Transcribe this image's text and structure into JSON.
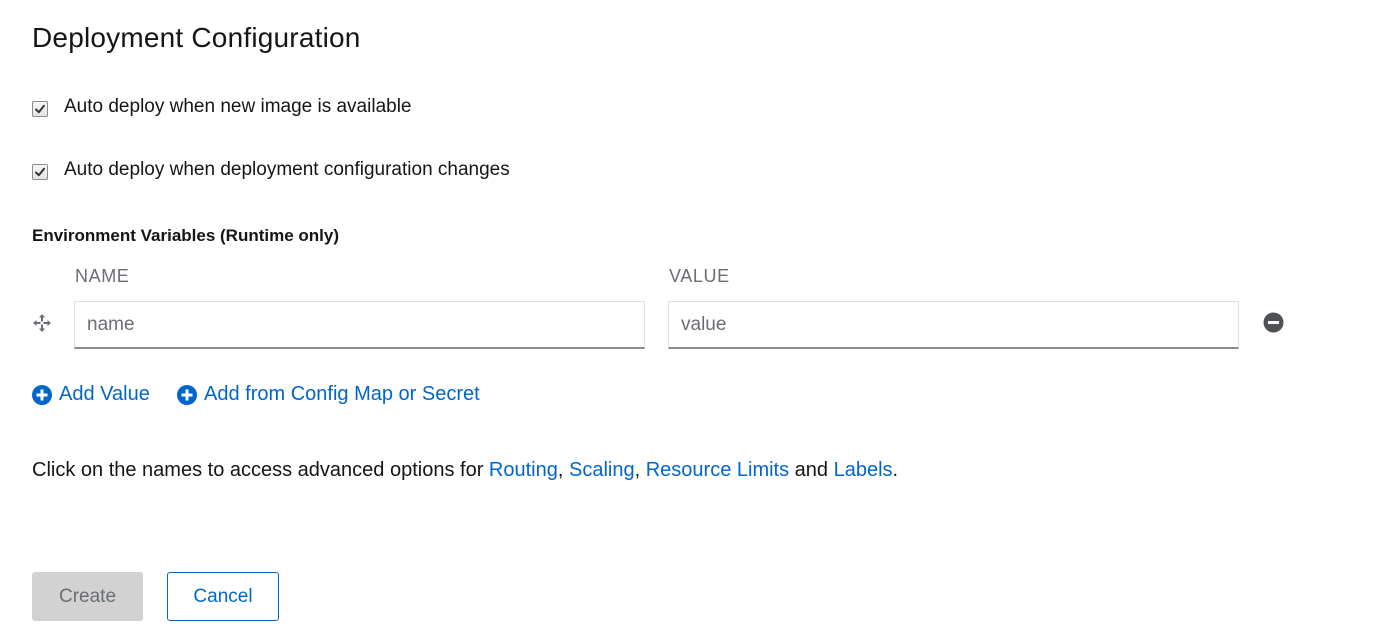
{
  "section_title": "Deployment Configuration",
  "checkboxes": [
    {
      "label": "Auto deploy when new image is available",
      "checked": true
    },
    {
      "label": "Auto deploy when deployment configuration changes",
      "checked": true
    }
  ],
  "env_vars": {
    "heading": "Environment Variables (Runtime only)",
    "name_header": "NAME",
    "value_header": "VALUE",
    "rows": [
      {
        "name_value": "",
        "name_placeholder": "name",
        "value_value": "",
        "value_placeholder": "value"
      }
    ],
    "add_value_label": "Add Value",
    "add_config_label": "Add from Config Map or Secret"
  },
  "advanced": {
    "prefix": "Click on the names to access advanced options for ",
    "links": [
      "Routing",
      "Scaling",
      "Resource Limits",
      "Labels"
    ],
    "sep1": ", ",
    "sep2": ", ",
    "and_text": " and ",
    "suffix": "."
  },
  "actions": {
    "create_label": "Create",
    "cancel_label": "Cancel"
  },
  "colors": {
    "link": "#0066cc",
    "text": "#151515",
    "muted": "#6a6e73",
    "disabled_bg": "#d2d2d2"
  },
  "icons": {
    "drag": "drag-handle-icon",
    "remove": "minus-circle-icon",
    "add": "plus-circle-icon",
    "check": "checkmark-icon"
  }
}
